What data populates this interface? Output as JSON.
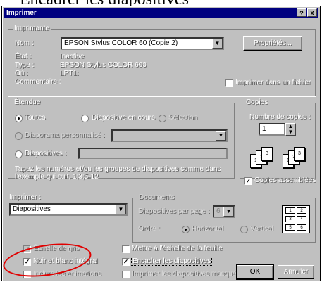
{
  "background_heading": "Encadrer les diapositives",
  "window": {
    "title": "Imprimer",
    "help_glyph": "?",
    "close_glyph": "X"
  },
  "printer": {
    "group_label": "Imprimante",
    "name_label": "Nom :",
    "name_value": "EPSON Stylus COLOR 60 (Copie 2)",
    "properties_button": "Propriétés...",
    "state_label": "État :",
    "state_value": "Inactive",
    "type_label": "Type :",
    "type_value": "EPSON Stylus COLOR 600",
    "where_label": "Où :",
    "where_value": "LPT1:",
    "comment_label": "Commentaire :",
    "print_to_file": "Imprimer dans un fichier"
  },
  "range": {
    "group_label": "Étendue",
    "all": "Toutes",
    "current": "Diapositive en cours",
    "selection": "Sélection",
    "custom_show": "Diaporama personnalisé :",
    "slides": "Diapositives :",
    "hint": "Tapez les numéros et/ou les groupes de diapositives comme dans l'exemple qui suit, 1;3;5-12"
  },
  "copies": {
    "group_label": "Copies",
    "count_label": "Nombre de copies :",
    "count_value": "1",
    "collate": "Copies assemblées"
  },
  "print_what": {
    "label": "Imprimer :",
    "value": "Diapositives"
  },
  "handouts": {
    "group_label": "Documents",
    "per_page_label": "Diapositives par page :",
    "per_page_value": "6",
    "order_label": "Ordre :",
    "horizontal": "Horizontal",
    "vertical": "Vertical",
    "preview_cells": [
      "1",
      "2",
      "3",
      "4",
      "5",
      "6"
    ]
  },
  "options": {
    "grayscale": "Échelle de gris",
    "pure_bw": "Noir et blanc intégral",
    "include_animations": "Inclure les animations",
    "scale_to_fit": "Mettre à l'échelle de la feuille",
    "frame_slides": "Encadrer les diapositives",
    "print_hidden": "Imprimer les diapositives masquées"
  },
  "buttons": {
    "ok": "OK",
    "cancel": "Annuler"
  },
  "annotation_color": "#e00000"
}
